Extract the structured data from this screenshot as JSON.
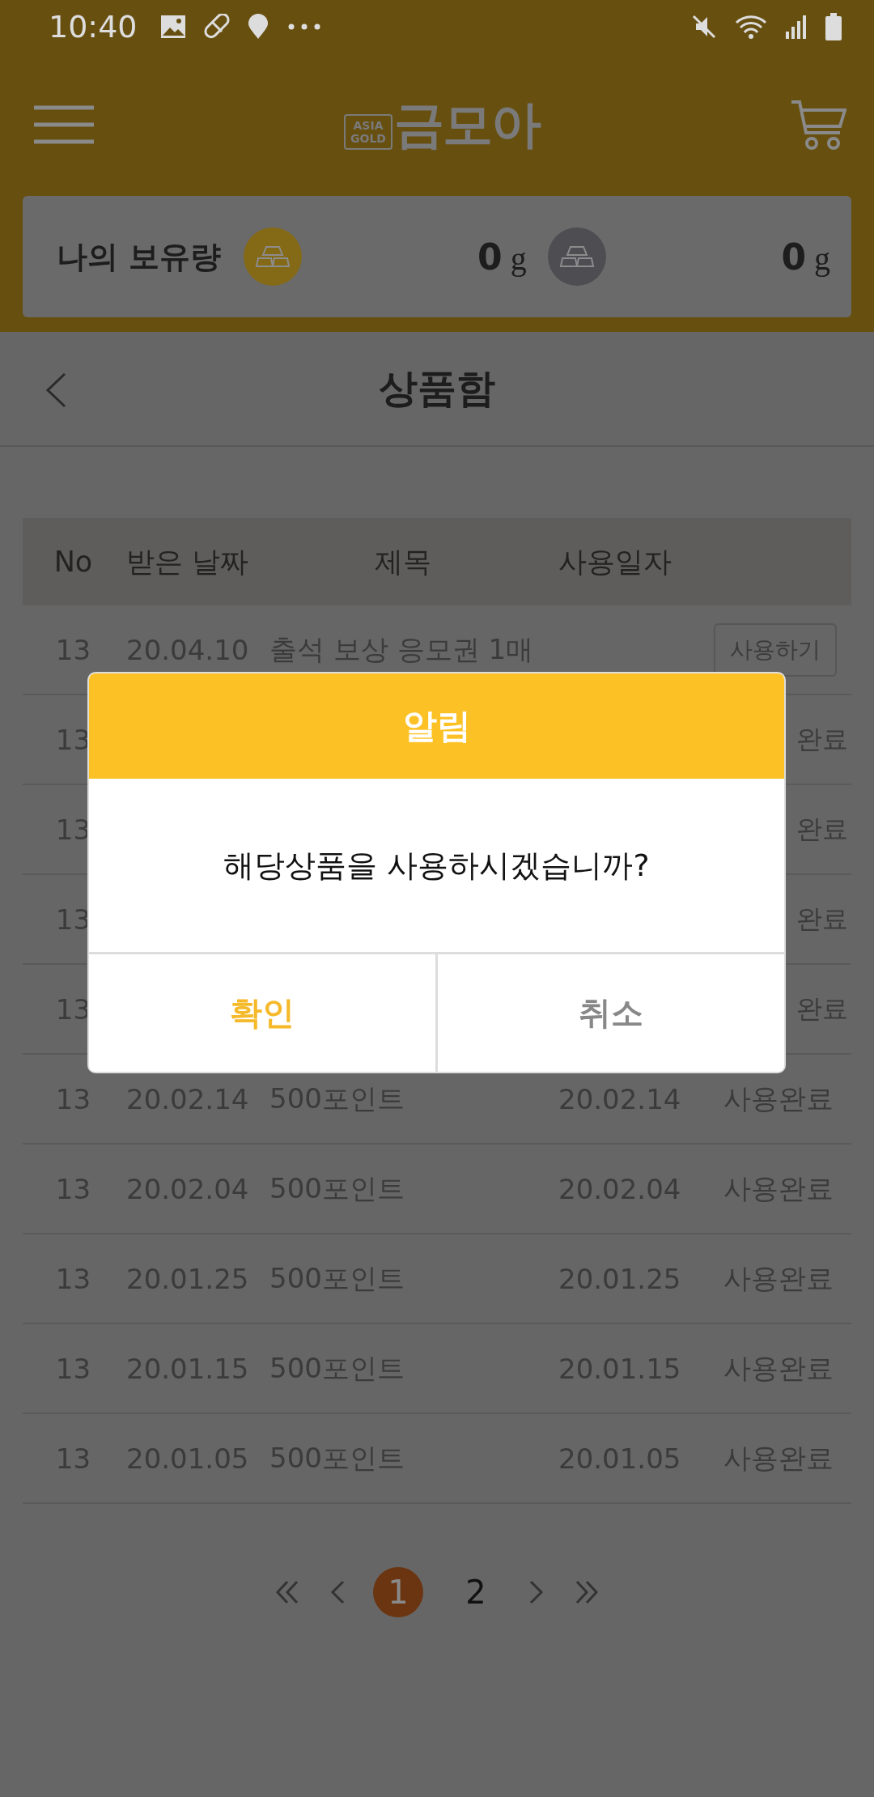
{
  "status_bar": {
    "time": "10:40"
  },
  "header": {
    "logo_badge": [
      "ASIA",
      "GOLD"
    ],
    "logo_text": "금모아"
  },
  "holdings": {
    "label": "나의 보유량",
    "items": [
      {
        "kind": "gold",
        "amount": "0",
        "unit": "g"
      },
      {
        "kind": "silver",
        "amount": "0",
        "unit": "g"
      }
    ]
  },
  "page_title": "상품함",
  "table": {
    "columns": [
      "No",
      "받은 날짜",
      "제목",
      "사용일자"
    ],
    "rows": [
      {
        "kind": "action",
        "no": "13",
        "date": "20.04.10",
        "title": "출석 보상 응모권 1매",
        "action": "사용하기"
      },
      {
        "kind": "covered",
        "no": "13",
        "status": "완료"
      },
      {
        "kind": "covered",
        "no": "13",
        "status": "완료"
      },
      {
        "kind": "covered",
        "no": "13",
        "status": "완료"
      },
      {
        "kind": "covered",
        "no": "13",
        "status": "완료"
      },
      {
        "kind": "used",
        "no": "13",
        "date": "20.02.14",
        "title": "500포인트",
        "used_date": "20.02.14",
        "status": "사용완료"
      },
      {
        "kind": "used",
        "no": "13",
        "date": "20.02.04",
        "title": "500포인트",
        "used_date": "20.02.04",
        "status": "사용완료"
      },
      {
        "kind": "used",
        "no": "13",
        "date": "20.01.25",
        "title": "500포인트",
        "used_date": "20.01.25",
        "status": "사용완료"
      },
      {
        "kind": "used",
        "no": "13",
        "date": "20.01.15",
        "title": "500포인트",
        "used_date": "20.01.15",
        "status": "사용완료"
      },
      {
        "kind": "used",
        "no": "13",
        "date": "20.01.05",
        "title": "500포인트",
        "used_date": "20.01.05",
        "status": "사용완료"
      }
    ]
  },
  "pagination": {
    "pages": [
      {
        "label": "1",
        "selected": true
      },
      {
        "label": "2",
        "selected": false
      }
    ]
  },
  "dialog": {
    "title": "알림",
    "message": "해당상품을 사용하시겠습니까?",
    "buttons": [
      {
        "label": "확인",
        "kind": "primary"
      },
      {
        "label": "취소",
        "kind": "secondary"
      }
    ]
  }
}
